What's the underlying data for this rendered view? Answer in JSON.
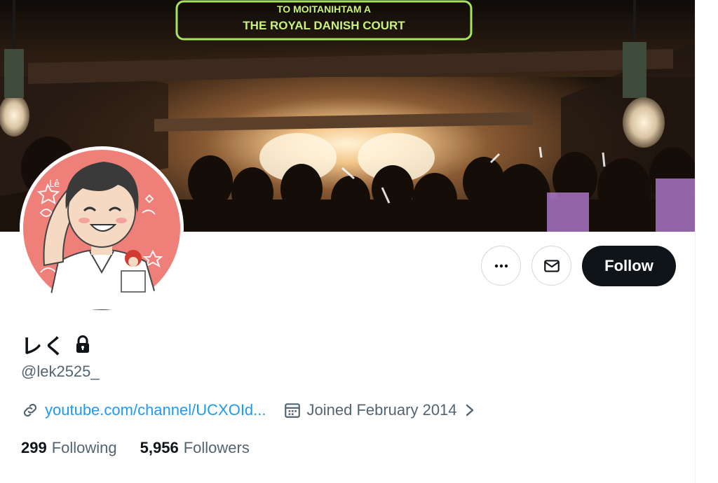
{
  "banner": {
    "sign_text": "THE ROYAL DANISH COURT",
    "sign_text_top": "TO MOITANIHTAM A"
  },
  "avatar": {
    "badge_text": "Lê"
  },
  "actions": {
    "more_icon": "more-horizontal-icon",
    "message_icon": "envelope-icon",
    "follow_label": "Follow"
  },
  "profile": {
    "display_name": "レく",
    "protected_icon": "lock-icon",
    "handle": "@lek2525_",
    "website": "youtube.com/channel/UCXOId...",
    "joined": "Joined February 2014"
  },
  "stats": {
    "following_count": "299",
    "following_label": "Following",
    "followers_count": "5,956",
    "followers_label": "Followers"
  },
  "colors": {
    "accent": "#1d9bf0",
    "text_primary": "#0f1419",
    "text_secondary": "#536471",
    "border": "#cfd9de",
    "avatar_bg": "#ef7f79"
  }
}
